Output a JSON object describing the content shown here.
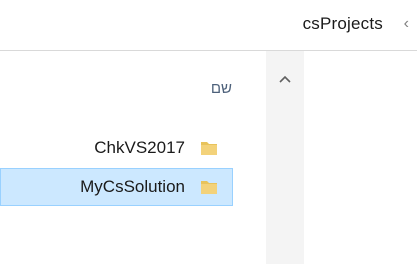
{
  "breadcrumb": {
    "current_folder": "csProjects",
    "separator": "‹"
  },
  "list": {
    "column_header": "שם",
    "items": [
      {
        "name": "ChkVS2017",
        "selected": false,
        "icon": "folder-icon"
      },
      {
        "name": "MyCsSolution",
        "selected": true,
        "icon": "folder-icon"
      }
    ]
  },
  "scrollbar": {
    "up_arrow_icon": "chevron-up-icon"
  },
  "colors": {
    "selection_bg": "#cce8ff",
    "selection_border": "#99d1ff",
    "folder": "#e8c35b"
  }
}
